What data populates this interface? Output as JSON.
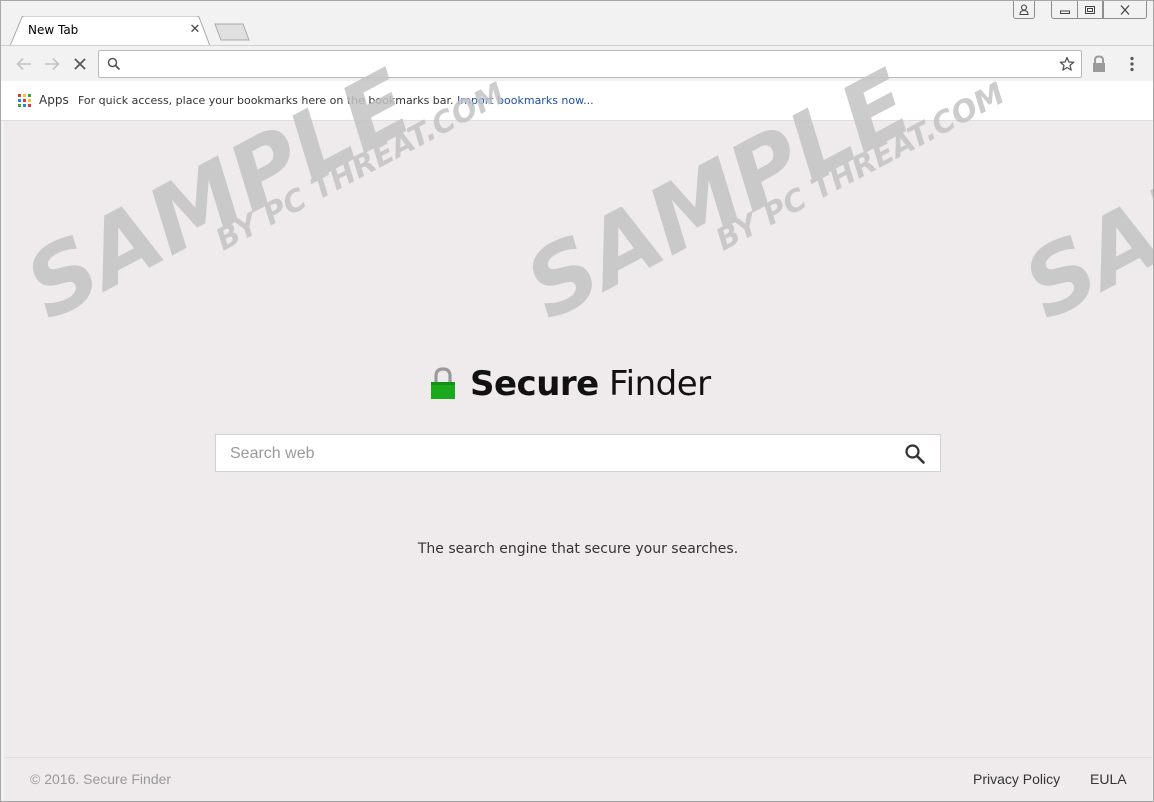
{
  "browser": {
    "tab": {
      "title": "New Tab",
      "close_glyph": "✕"
    },
    "omnibox": {
      "value": "",
      "placeholder": ""
    },
    "bookmarks": {
      "apps_label": "Apps",
      "hint": "For quick access, place your bookmarks here on the bookmarks bar.",
      "import_link": "Import bookmarks now..."
    },
    "icons": [
      "user-icon",
      "minimize-icon",
      "maximize-icon",
      "close-icon",
      "back-arrow-icon",
      "forward-arrow-icon",
      "stop-icon",
      "search-icon",
      "star-icon",
      "lock-icon",
      "menu-icon"
    ]
  },
  "page": {
    "logo": {
      "bold": "Secure",
      "regular": " Finder",
      "lock_color": "#1aa81d"
    },
    "search": {
      "placeholder": "Search web",
      "value": ""
    },
    "tagline": "The search engine that secure your searches.",
    "footer": {
      "copyright": "© 2016. Secure Finder",
      "links": [
        "Privacy Policy",
        "EULA"
      ]
    }
  },
  "watermark": {
    "main": "SAMPLE",
    "sub": "BY PC THREAT.COM"
  }
}
